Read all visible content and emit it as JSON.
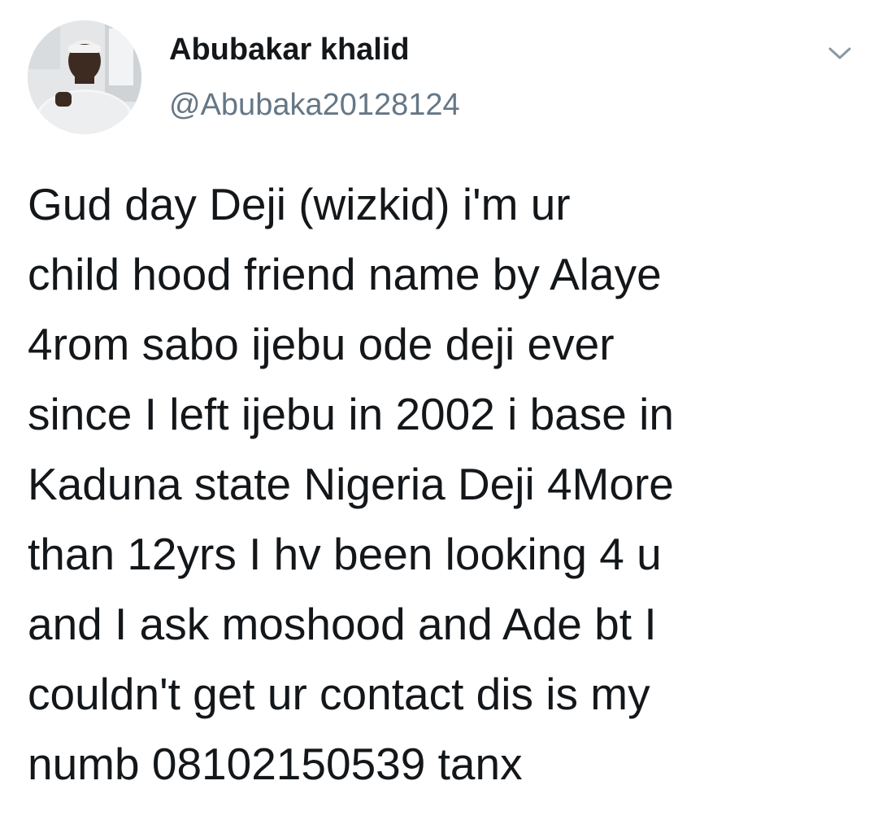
{
  "author": {
    "name": "Abubakar khalid",
    "handle": "@Abubaka20128124",
    "avatar_icon": "profile-photo"
  },
  "menu": {
    "icon": "chevron-down-icon"
  },
  "tweet": {
    "lines": [
      "Gud day Deji (wizkid) i'm ur",
      "child hood friend name by Alaye",
      "4rom sabo ijebu ode deji ever",
      "since I left ijebu in 2002 i base in",
      "Kaduna state Nigeria Deji 4More",
      "than 12yrs I hv been looking 4 u",
      "and I ask moshood and Ade bt I",
      "couldn't get ur contact dis is my",
      "numb 08102150539 tanx"
    ]
  },
  "colors": {
    "text": "#14171a",
    "secondary": "#657786",
    "background": "#ffffff"
  }
}
